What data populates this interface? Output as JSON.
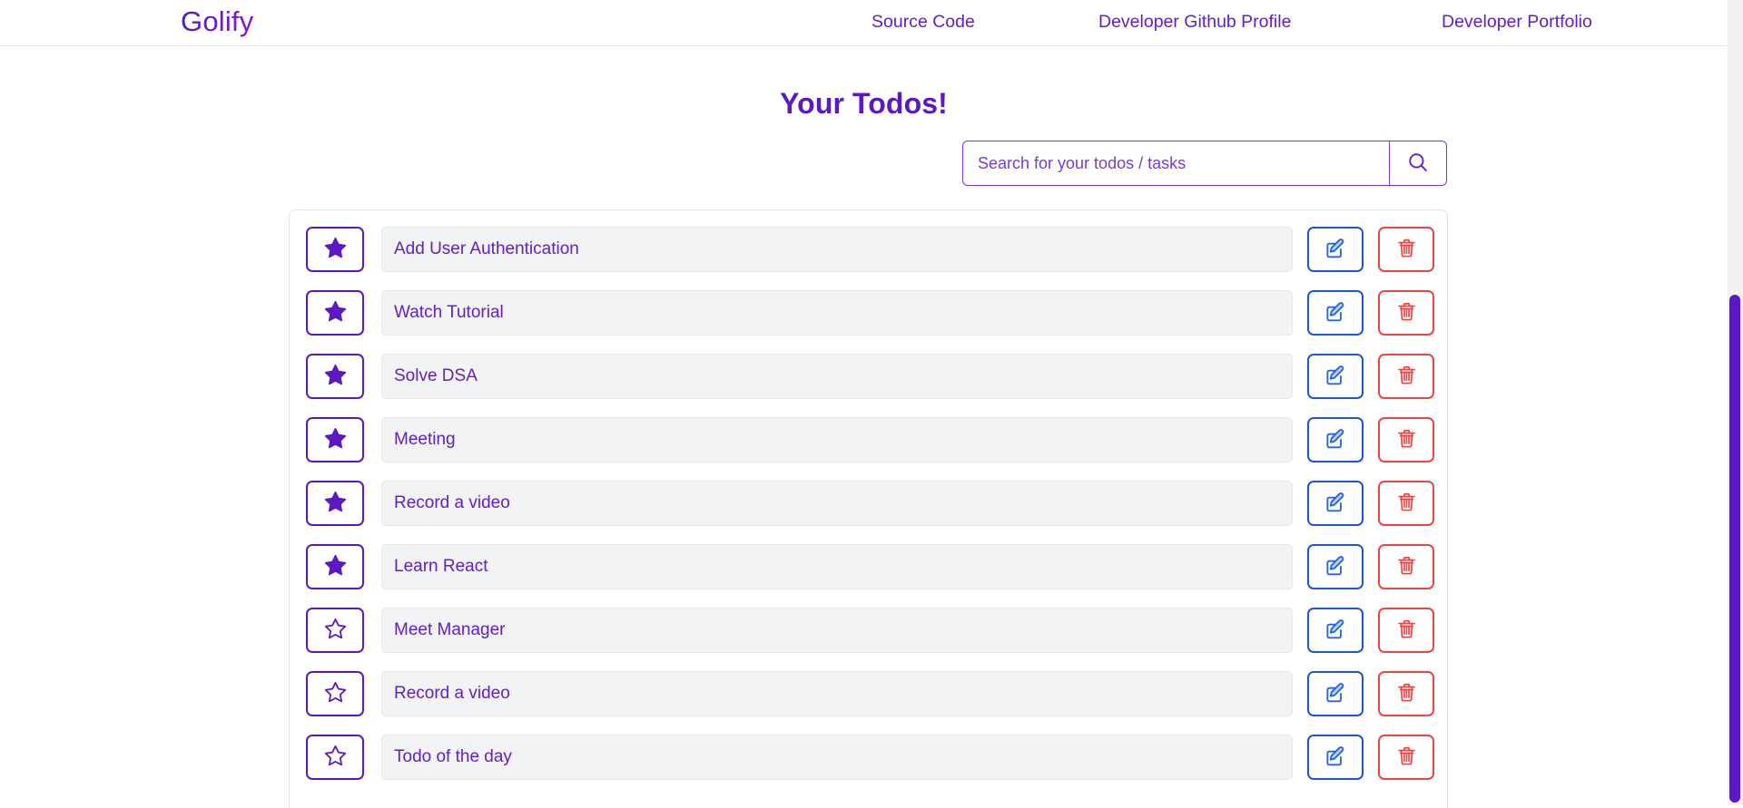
{
  "brand": {
    "name": "Golify"
  },
  "nav": {
    "links": [
      {
        "label": "Source Code"
      },
      {
        "label": "Developer Github Profile"
      },
      {
        "label": "Developer Portfolio"
      }
    ]
  },
  "page": {
    "title": "Your Todos!"
  },
  "search": {
    "placeholder": "Search for your todos / tasks",
    "value": "",
    "icon": "search-icon"
  },
  "colors": {
    "brand_purple": "#5b18c4",
    "text_purple": "#6320c6",
    "edit_blue": "#1a56db",
    "delete_red": "#ef4444",
    "field_bg": "#f1f3f5",
    "scrollbar_thumb": "#5b18c4"
  },
  "actions": {
    "star_icon": "star-icon",
    "edit_icon": "edit-pencil-icon",
    "delete_icon": "trash-icon"
  },
  "todos": [
    {
      "title": "Add User Authentication",
      "starred": true
    },
    {
      "title": "Watch Tutorial",
      "starred": true
    },
    {
      "title": "Solve DSA",
      "starred": true
    },
    {
      "title": "Meeting",
      "starred": true
    },
    {
      "title": "Record a video",
      "starred": true
    },
    {
      "title": "Learn React",
      "starred": true
    },
    {
      "title": "Meet Manager",
      "starred": false
    },
    {
      "title": "Record a video",
      "starred": false
    },
    {
      "title": "Todo of the day",
      "starred": false
    }
  ]
}
